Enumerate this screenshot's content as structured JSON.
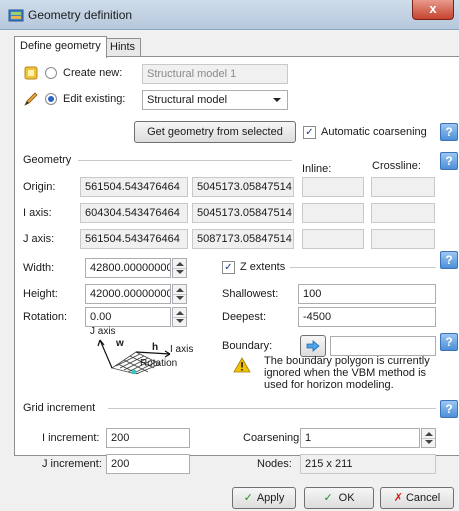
{
  "window": {
    "title": "Geometry definition",
    "close_glyph": "x"
  },
  "tabs": [
    {
      "label": "Define geometry",
      "active": true
    },
    {
      "label": "Hints",
      "active": false
    }
  ],
  "mode": {
    "create_new_label": "Create new:",
    "create_new_value": "Structural model 1",
    "edit_existing_label": "Edit existing:",
    "edit_existing_value": "Structural model",
    "selected": "edit_existing"
  },
  "actions": {
    "get_geometry_label": "Get geometry from selected",
    "automatic_coarsening_label": "Automatic coarsening",
    "automatic_coarsening_checked": true,
    "help_glyph": "?"
  },
  "geometry": {
    "section_label": "Geometry",
    "inline_header": "Inline:",
    "crossline_header": "Crossline:",
    "rows": [
      {
        "label": "Origin:",
        "x": "561504.543476464",
        "y": "5045173.05847514"
      },
      {
        "label": "I axis:",
        "x": "604304.543476464",
        "y": "5045173.05847514"
      },
      {
        "label": "J axis:",
        "x": "561504.543476464",
        "y": "5087173.05847514"
      }
    ],
    "width_label": "Width:",
    "width_value": "42800.00000000",
    "height_label": "Height:",
    "height_value": "42000.00000000",
    "rotation_label": "Rotation:",
    "rotation_value": "0.00",
    "z_extents_label": "Z extents",
    "z_extents_checked": true,
    "shallowest_label": "Shallowest:",
    "shallowest_value": "100",
    "deepest_label": "Deepest:",
    "deepest_value": "-4500",
    "boundary_label": "Boundary:",
    "boundary_value": "",
    "warning_text": "The boundary polygon is currently ignored when the VBM method is used for horizon modeling.",
    "diagram": {
      "j_axis_label": "J axis",
      "w_label": "w",
      "h_label": "h",
      "i_axis_label": "I axis",
      "rotation_label": "Rotation"
    }
  },
  "grid_increment": {
    "section_label": "Grid increment",
    "i_increment_label": "I increment:",
    "i_increment_value": "200",
    "j_increment_label": "J increment:",
    "j_increment_value": "200",
    "coarsening_label": "Coarsening:",
    "coarsening_value": "1",
    "nodes_label": "Nodes:",
    "nodes_value": "215 x 211"
  },
  "footer": {
    "apply_label": "Apply",
    "ok_label": "OK",
    "cancel_label": "Cancel"
  },
  "colors": {
    "help_button": "#4d8fd8",
    "check_green": "#1f8f1f",
    "cancel_red": "#d41b1b",
    "warning_yellow": "#f5c400"
  }
}
